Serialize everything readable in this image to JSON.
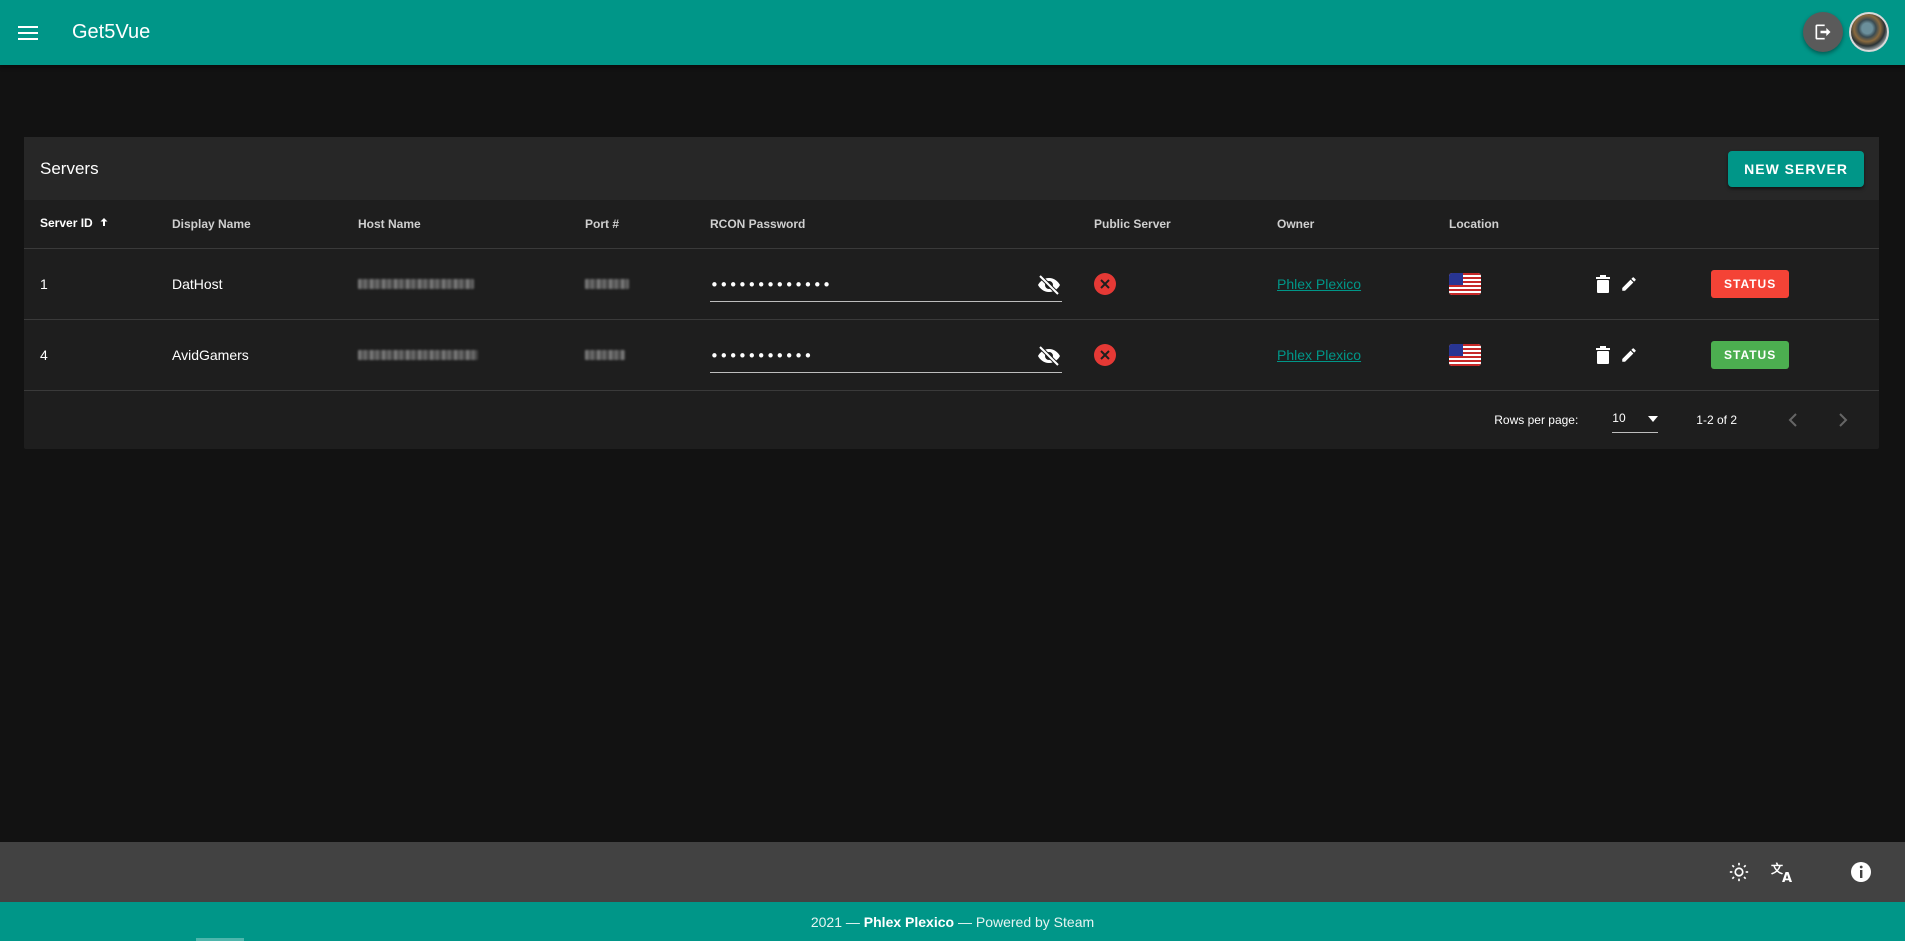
{
  "app": {
    "title": "Get5Vue"
  },
  "card": {
    "title": "Servers",
    "new_server_label": "NEW SERVER"
  },
  "table": {
    "headers": {
      "server_id": "Server ID",
      "display_name": "Display Name",
      "host_name": "Host Name",
      "port": "Port #",
      "rcon_password": "RCON Password",
      "public_server": "Public Server",
      "owner": "Owner",
      "location": "Location"
    },
    "rows": [
      {
        "id": "1",
        "display_name": "DatHost",
        "rcon_masked": "•••••••••••••",
        "public": false,
        "owner": "Phlex Plexico",
        "location": "us-flag",
        "status_label": "STATUS",
        "status_color": "#f44336"
      },
      {
        "id": "4",
        "display_name": "AvidGamers",
        "rcon_masked": "•••••••••••",
        "public": false,
        "owner": "Phlex Plexico",
        "location": "us-flag",
        "status_label": "STATUS",
        "status_color": "#4caf50"
      }
    ]
  },
  "pagination": {
    "rows_per_page_label": "Rows per page:",
    "rows_per_page": "10",
    "range": "1-2 of 2"
  },
  "footer": {
    "year": "2021 —",
    "author": "Phlex Plexico",
    "powered": "— Powered by Steam"
  },
  "colors": {
    "primary": "#009688",
    "danger": "#e53935",
    "success": "#4caf50",
    "background": "#121212"
  }
}
